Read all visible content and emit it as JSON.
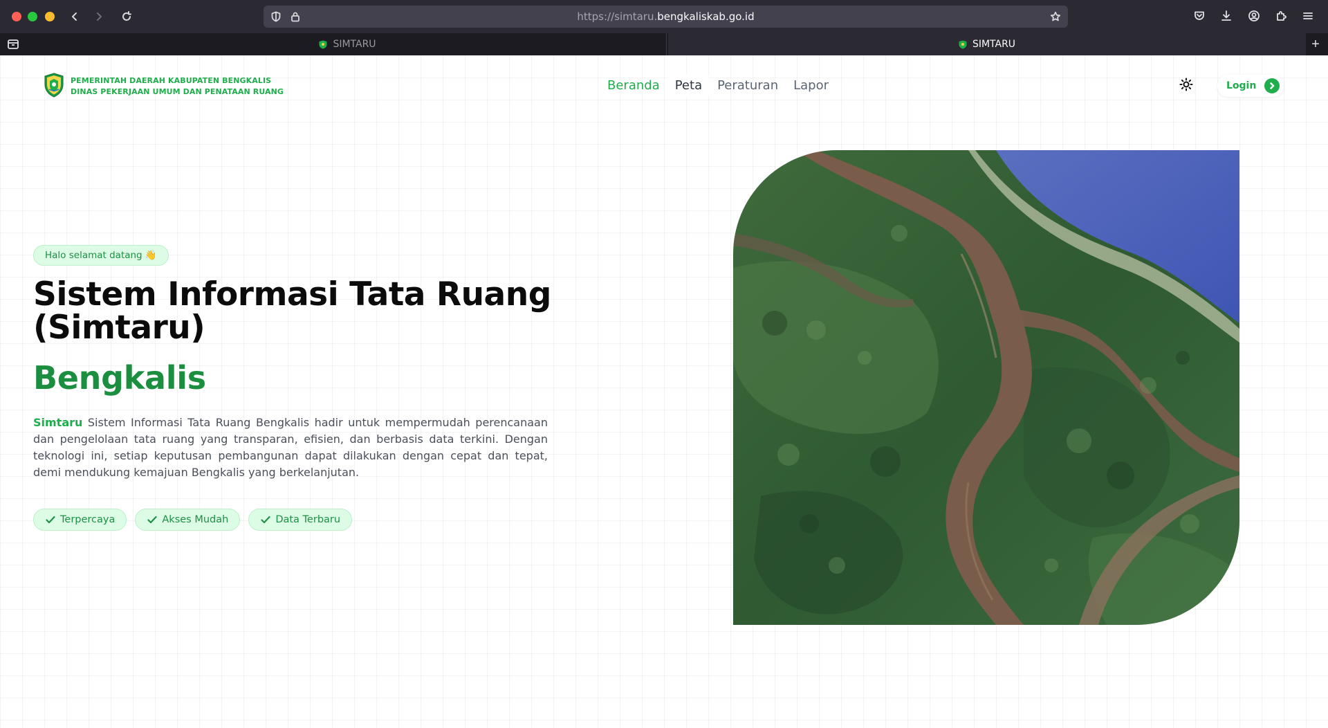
{
  "browser": {
    "url_prefix": "https://simtaru.",
    "url_domain": "bengkaliskab.go.id",
    "tabs": [
      {
        "title": "SIMTARU"
      },
      {
        "title": "SIMTARU"
      }
    ],
    "new_tab_label": "+"
  },
  "header": {
    "brand_line1": "PEMERINTAH DAERAH KABUPATEN BENGKALIS",
    "brand_line2": "DINAS PEKERJAAN UMUM DAN PENATAAN RUANG",
    "nav": [
      {
        "label": "Beranda",
        "active": true
      },
      {
        "label": "Peta"
      },
      {
        "label": "Peraturan"
      },
      {
        "label": "Lapor"
      }
    ],
    "login_label": "Login"
  },
  "hero": {
    "badge": "Halo selamat datang 👋",
    "title_line1": "Sistem Informasi Tata Ruang",
    "title_line2": "(Simtaru)",
    "subtitle": "Bengkalis",
    "desc_accent": "Simtaru",
    "desc_text": " Sistem Informasi Tata Ruang Bengkalis hadir untuk mempermudah perencanaan dan pengelolaan tata ruang yang transparan, efisien, dan berbasis data terkini. Dengan teknologi ini, setiap keputusan pembangunan dapat dilakukan dengan cepat dan tepat, demi mendukung kemajuan Bengkalis yang berkelanjutan.",
    "features": [
      {
        "label": "Terpercaya"
      },
      {
        "label": "Akses Mudah"
      },
      {
        "label": "Data Terbaru"
      }
    ]
  },
  "colors": {
    "accent": "#1fae4b",
    "accent_dark": "#1b8f3f",
    "chip_bg": "#dcfce5"
  },
  "icons": [
    "shield-icon",
    "lock-icon",
    "star-icon",
    "pocket-icon",
    "download-icon",
    "account-icon",
    "extensions-icon",
    "menu-icon",
    "sun-icon",
    "chevron-right-icon",
    "check-icon"
  ]
}
